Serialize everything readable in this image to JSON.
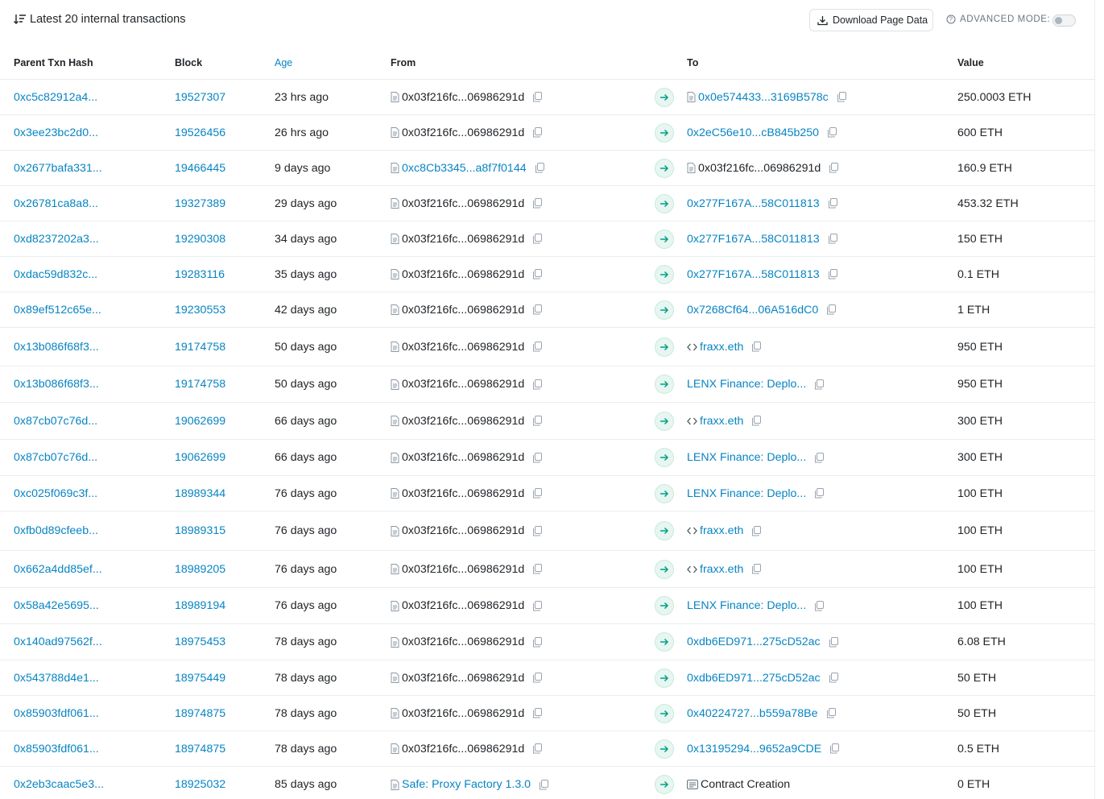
{
  "header": {
    "title": "Latest 20 internal transactions",
    "download_label": "Download Page Data",
    "advanced_label": "ADVANCED MODE:"
  },
  "columns": {
    "hash": "Parent Txn Hash",
    "block": "Block",
    "age": "Age",
    "from": "From",
    "to": "To",
    "value": "Value"
  },
  "rows": [
    {
      "hash": "0xc5c82912a4...",
      "block": "19527307",
      "age": "23 hrs ago",
      "from": "0x03f216fc...06986291d",
      "from_link": false,
      "from_icon": "file-icon",
      "to": "0x0e574433...3169B578c",
      "to_link": true,
      "to_icon": "file-icon",
      "value": "250.0003 ETH"
    },
    {
      "hash": "0x3ee23bc2d0...",
      "block": "19526456",
      "age": "26 hrs ago",
      "from": "0x03f216fc...06986291d",
      "from_link": false,
      "from_icon": "file-icon",
      "to": "0x2eC56e10...cB845b250",
      "to_link": true,
      "to_icon": "",
      "value": "600 ETH"
    },
    {
      "hash": "0x2677bafa331...",
      "block": "19466445",
      "age": "9 days ago",
      "from": "0xc8Cb3345...a8f7f0144",
      "from_link": true,
      "from_icon": "file-icon",
      "to": "0x03f216fc...06986291d",
      "to_link": false,
      "to_icon": "file-icon",
      "value": "160.9 ETH"
    },
    {
      "hash": "0x26781ca8a8...",
      "block": "19327389",
      "age": "29 days ago",
      "from": "0x03f216fc...06986291d",
      "from_link": false,
      "from_icon": "file-icon",
      "to": "0x277F167A...58C011813",
      "to_link": true,
      "to_icon": "",
      "value": "453.32 ETH"
    },
    {
      "hash": "0xd8237202a3...",
      "block": "19290308",
      "age": "34 days ago",
      "from": "0x03f216fc...06986291d",
      "from_link": false,
      "from_icon": "file-icon",
      "to": "0x277F167A...58C011813",
      "to_link": true,
      "to_icon": "",
      "value": "150 ETH"
    },
    {
      "hash": "0xdac59d832c...",
      "block": "19283116",
      "age": "35 days ago",
      "from": "0x03f216fc...06986291d",
      "from_link": false,
      "from_icon": "file-icon",
      "to": "0x277F167A...58C011813",
      "to_link": true,
      "to_icon": "",
      "value": "0.1 ETH"
    },
    {
      "hash": "0x89ef512c65e...",
      "block": "19230553",
      "age": "42 days ago",
      "from": "0x03f216fc...06986291d",
      "from_link": false,
      "from_icon": "file-icon",
      "to": "0x7268Cf64...06A516dC0",
      "to_link": true,
      "to_icon": "",
      "value": "1 ETH"
    },
    {
      "hash": "0x13b086f68f3...",
      "block": "19174758",
      "age": "50 days ago",
      "from": "0x03f216fc...06986291d",
      "from_link": false,
      "from_icon": "file-icon",
      "to": "fraxx.eth",
      "to_link": true,
      "to_icon": "code-icon",
      "value": "950 ETH"
    },
    {
      "hash": "0x13b086f68f3...",
      "block": "19174758",
      "age": "50 days ago",
      "from": "0x03f216fc...06986291d",
      "from_link": false,
      "from_icon": "file-icon",
      "to": "LENX Finance: Deplo...",
      "to_link": true,
      "to_icon": "",
      "value": "950 ETH"
    },
    {
      "hash": "0x87cb07c76d...",
      "block": "19062699",
      "age": "66 days ago",
      "from": "0x03f216fc...06986291d",
      "from_link": false,
      "from_icon": "file-icon",
      "to": "fraxx.eth",
      "to_link": true,
      "to_icon": "code-icon",
      "value": "300 ETH"
    },
    {
      "hash": "0x87cb07c76d...",
      "block": "19062699",
      "age": "66 days ago",
      "from": "0x03f216fc...06986291d",
      "from_link": false,
      "from_icon": "file-icon",
      "to": "LENX Finance: Deplo...",
      "to_link": true,
      "to_icon": "",
      "value": "300 ETH"
    },
    {
      "hash": "0xc025f069c3f...",
      "block": "18989344",
      "age": "76 days ago",
      "from": "0x03f216fc...06986291d",
      "from_link": false,
      "from_icon": "file-icon",
      "to": "LENX Finance: Deplo...",
      "to_link": true,
      "to_icon": "",
      "value": "100 ETH"
    },
    {
      "hash": "0xfb0d89cfeeb...",
      "block": "18989315",
      "age": "76 days ago",
      "from": "0x03f216fc...06986291d",
      "from_link": false,
      "from_icon": "file-icon",
      "to": "fraxx.eth",
      "to_link": true,
      "to_icon": "code-icon",
      "value": "100 ETH"
    },
    {
      "hash": "0x662a4dd85ef...",
      "block": "18989205",
      "age": "76 days ago",
      "from": "0x03f216fc...06986291d",
      "from_link": false,
      "from_icon": "file-icon",
      "to": "fraxx.eth",
      "to_link": true,
      "to_icon": "code-icon",
      "value": "100 ETH"
    },
    {
      "hash": "0x58a42e5695...",
      "block": "18989194",
      "age": "76 days ago",
      "from": "0x03f216fc...06986291d",
      "from_link": false,
      "from_icon": "file-icon",
      "to": "LENX Finance: Deplo...",
      "to_link": true,
      "to_icon": "",
      "value": "100 ETH"
    },
    {
      "hash": "0x140ad97562f...",
      "block": "18975453",
      "age": "78 days ago",
      "from": "0x03f216fc...06986291d",
      "from_link": false,
      "from_icon": "file-icon",
      "to": "0xdb6ED971...275cD52ac",
      "to_link": true,
      "to_icon": "",
      "value": "6.08 ETH"
    },
    {
      "hash": "0x543788d4e1...",
      "block": "18975449",
      "age": "78 days ago",
      "from": "0x03f216fc...06986291d",
      "from_link": false,
      "from_icon": "file-icon",
      "to": "0xdb6ED971...275cD52ac",
      "to_link": true,
      "to_icon": "",
      "value": "50 ETH"
    },
    {
      "hash": "0x85903fdf061...",
      "block": "18974875",
      "age": "78 days ago",
      "from": "0x03f216fc...06986291d",
      "from_link": false,
      "from_icon": "file-icon",
      "to": "0x40224727...b559a78Be",
      "to_link": true,
      "to_icon": "",
      "value": "50 ETH"
    },
    {
      "hash": "0x85903fdf061...",
      "block": "18974875",
      "age": "78 days ago",
      "from": "0x03f216fc...06986291d",
      "from_link": false,
      "from_icon": "file-icon",
      "to": "0x13195294...9652a9CDE",
      "to_link": true,
      "to_icon": "",
      "value": "0.5 ETH"
    },
    {
      "hash": "0x2eb3caac5e3...",
      "block": "18925032",
      "age": "85 days ago",
      "from": "Safe: Proxy Factory 1.3.0",
      "from_link": true,
      "from_icon": "file-icon",
      "to": "Contract Creation",
      "to_link": false,
      "to_icon": "contract-creation-icon",
      "value": "0 ETH"
    }
  ]
}
